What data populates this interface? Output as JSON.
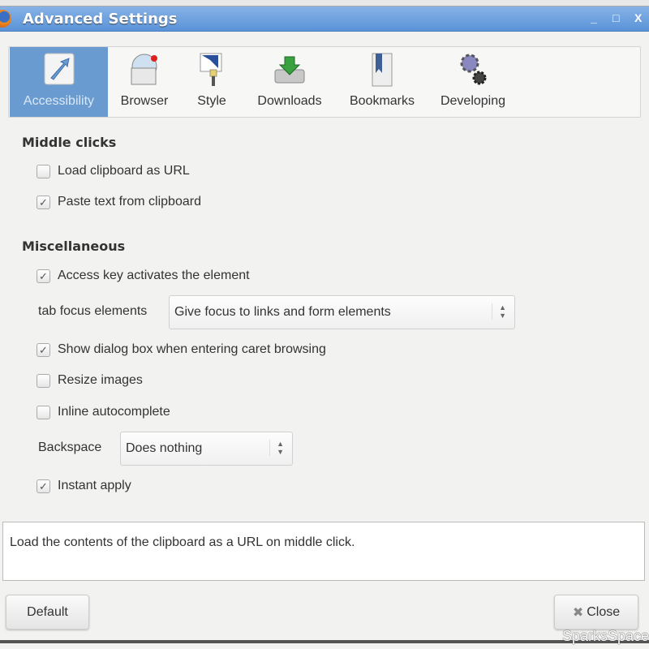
{
  "window": {
    "title": "Advanced Settings",
    "minimize": "_",
    "maximize": "□",
    "close": "X"
  },
  "tabs": [
    {
      "label": "Accessibility",
      "icon": "arrow-pointer-icon",
      "selected": true
    },
    {
      "label": "Browser",
      "icon": "browser-globe-icon"
    },
    {
      "label": "Style",
      "icon": "paintbrush-icon"
    },
    {
      "label": "Downloads",
      "icon": "download-drive-icon"
    },
    {
      "label": "Bookmarks",
      "icon": "bookmark-book-icon"
    },
    {
      "label": "Developing",
      "icon": "gears-icon"
    }
  ],
  "sections": {
    "middle_clicks": {
      "heading": "Middle clicks",
      "load_clipboard": {
        "label": "Load clipboard as URL",
        "checked": false
      },
      "paste_text": {
        "label": "Paste text from clipboard",
        "checked": true
      }
    },
    "misc": {
      "heading": "Miscellaneous",
      "access_key": {
        "label": "Access key activates the element",
        "checked": true
      },
      "tab_focus": {
        "label": "tab focus elements",
        "value": "Give focus to links and form elements"
      },
      "show_dialog": {
        "label": "Show dialog box when entering caret browsing",
        "checked": true
      },
      "resize_images": {
        "label": "Resize images",
        "checked": false
      },
      "inline_autocomplete": {
        "label": "Inline autocomplete",
        "checked": false
      },
      "backspace": {
        "label": "Backspace",
        "value": "Does nothing"
      },
      "instant_apply": {
        "label": "Instant apply",
        "checked": true
      }
    }
  },
  "description": "Load the contents of the clipboard as a URL on middle click.",
  "buttons": {
    "default": "Default",
    "close": "Close",
    "close_icon": "✖"
  },
  "watermark": "SparksSpace",
  "check": "✓",
  "arrows": "▲▼"
}
